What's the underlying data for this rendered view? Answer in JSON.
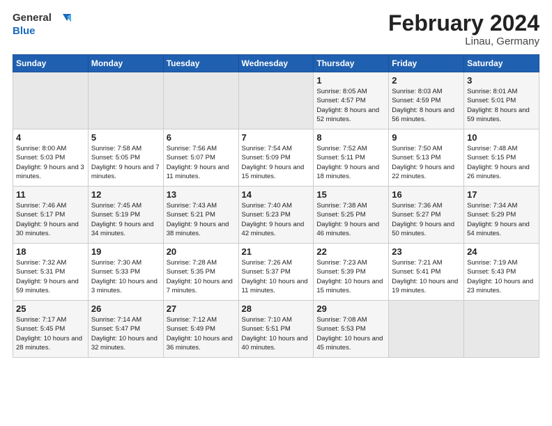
{
  "logo": {
    "text_general": "General",
    "text_blue": "Blue"
  },
  "title": "February 2024",
  "location": "Linau, Germany",
  "days_header": [
    "Sunday",
    "Monday",
    "Tuesday",
    "Wednesday",
    "Thursday",
    "Friday",
    "Saturday"
  ],
  "weeks": [
    [
      {
        "day": "",
        "empty": true
      },
      {
        "day": "",
        "empty": true
      },
      {
        "day": "",
        "empty": true
      },
      {
        "day": "",
        "empty": true
      },
      {
        "day": "1",
        "sunrise": "Sunrise: 8:05 AM",
        "sunset": "Sunset: 4:57 PM",
        "daylight": "Daylight: 8 hours and 52 minutes."
      },
      {
        "day": "2",
        "sunrise": "Sunrise: 8:03 AM",
        "sunset": "Sunset: 4:59 PM",
        "daylight": "Daylight: 8 hours and 56 minutes."
      },
      {
        "day": "3",
        "sunrise": "Sunrise: 8:01 AM",
        "sunset": "Sunset: 5:01 PM",
        "daylight": "Daylight: 8 hours and 59 minutes."
      }
    ],
    [
      {
        "day": "4",
        "sunrise": "Sunrise: 8:00 AM",
        "sunset": "Sunset: 5:03 PM",
        "daylight": "Daylight: 9 hours and 3 minutes."
      },
      {
        "day": "5",
        "sunrise": "Sunrise: 7:58 AM",
        "sunset": "Sunset: 5:05 PM",
        "daylight": "Daylight: 9 hours and 7 minutes."
      },
      {
        "day": "6",
        "sunrise": "Sunrise: 7:56 AM",
        "sunset": "Sunset: 5:07 PM",
        "daylight": "Daylight: 9 hours and 11 minutes."
      },
      {
        "day": "7",
        "sunrise": "Sunrise: 7:54 AM",
        "sunset": "Sunset: 5:09 PM",
        "daylight": "Daylight: 9 hours and 15 minutes."
      },
      {
        "day": "8",
        "sunrise": "Sunrise: 7:52 AM",
        "sunset": "Sunset: 5:11 PM",
        "daylight": "Daylight: 9 hours and 18 minutes."
      },
      {
        "day": "9",
        "sunrise": "Sunrise: 7:50 AM",
        "sunset": "Sunset: 5:13 PM",
        "daylight": "Daylight: 9 hours and 22 minutes."
      },
      {
        "day": "10",
        "sunrise": "Sunrise: 7:48 AM",
        "sunset": "Sunset: 5:15 PM",
        "daylight": "Daylight: 9 hours and 26 minutes."
      }
    ],
    [
      {
        "day": "11",
        "sunrise": "Sunrise: 7:46 AM",
        "sunset": "Sunset: 5:17 PM",
        "daylight": "Daylight: 9 hours and 30 minutes."
      },
      {
        "day": "12",
        "sunrise": "Sunrise: 7:45 AM",
        "sunset": "Sunset: 5:19 PM",
        "daylight": "Daylight: 9 hours and 34 minutes."
      },
      {
        "day": "13",
        "sunrise": "Sunrise: 7:43 AM",
        "sunset": "Sunset: 5:21 PM",
        "daylight": "Daylight: 9 hours and 38 minutes."
      },
      {
        "day": "14",
        "sunrise": "Sunrise: 7:40 AM",
        "sunset": "Sunset: 5:23 PM",
        "daylight": "Daylight: 9 hours and 42 minutes."
      },
      {
        "day": "15",
        "sunrise": "Sunrise: 7:38 AM",
        "sunset": "Sunset: 5:25 PM",
        "daylight": "Daylight: 9 hours and 46 minutes."
      },
      {
        "day": "16",
        "sunrise": "Sunrise: 7:36 AM",
        "sunset": "Sunset: 5:27 PM",
        "daylight": "Daylight: 9 hours and 50 minutes."
      },
      {
        "day": "17",
        "sunrise": "Sunrise: 7:34 AM",
        "sunset": "Sunset: 5:29 PM",
        "daylight": "Daylight: 9 hours and 54 minutes."
      }
    ],
    [
      {
        "day": "18",
        "sunrise": "Sunrise: 7:32 AM",
        "sunset": "Sunset: 5:31 PM",
        "daylight": "Daylight: 9 hours and 59 minutes."
      },
      {
        "day": "19",
        "sunrise": "Sunrise: 7:30 AM",
        "sunset": "Sunset: 5:33 PM",
        "daylight": "Daylight: 10 hours and 3 minutes."
      },
      {
        "day": "20",
        "sunrise": "Sunrise: 7:28 AM",
        "sunset": "Sunset: 5:35 PM",
        "daylight": "Daylight: 10 hours and 7 minutes."
      },
      {
        "day": "21",
        "sunrise": "Sunrise: 7:26 AM",
        "sunset": "Sunset: 5:37 PM",
        "daylight": "Daylight: 10 hours and 11 minutes."
      },
      {
        "day": "22",
        "sunrise": "Sunrise: 7:23 AM",
        "sunset": "Sunset: 5:39 PM",
        "daylight": "Daylight: 10 hours and 15 minutes."
      },
      {
        "day": "23",
        "sunrise": "Sunrise: 7:21 AM",
        "sunset": "Sunset: 5:41 PM",
        "daylight": "Daylight: 10 hours and 19 minutes."
      },
      {
        "day": "24",
        "sunrise": "Sunrise: 7:19 AM",
        "sunset": "Sunset: 5:43 PM",
        "daylight": "Daylight: 10 hours and 23 minutes."
      }
    ],
    [
      {
        "day": "25",
        "sunrise": "Sunrise: 7:17 AM",
        "sunset": "Sunset: 5:45 PM",
        "daylight": "Daylight: 10 hours and 28 minutes."
      },
      {
        "day": "26",
        "sunrise": "Sunrise: 7:14 AM",
        "sunset": "Sunset: 5:47 PM",
        "daylight": "Daylight: 10 hours and 32 minutes."
      },
      {
        "day": "27",
        "sunrise": "Sunrise: 7:12 AM",
        "sunset": "Sunset: 5:49 PM",
        "daylight": "Daylight: 10 hours and 36 minutes."
      },
      {
        "day": "28",
        "sunrise": "Sunrise: 7:10 AM",
        "sunset": "Sunset: 5:51 PM",
        "daylight": "Daylight: 10 hours and 40 minutes."
      },
      {
        "day": "29",
        "sunrise": "Sunrise: 7:08 AM",
        "sunset": "Sunset: 5:53 PM",
        "daylight": "Daylight: 10 hours and 45 minutes."
      },
      {
        "day": "",
        "empty": true
      },
      {
        "day": "",
        "empty": true
      }
    ]
  ]
}
